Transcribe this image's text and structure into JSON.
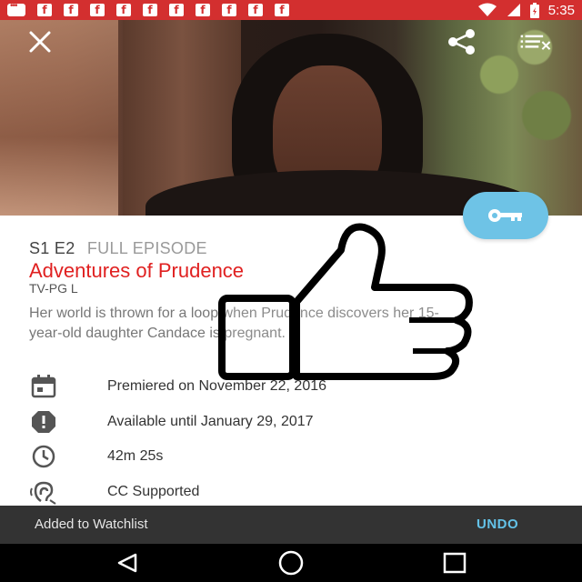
{
  "status_bar": {
    "time": "5:35",
    "notifications": [
      "message-icon",
      "facebook-icon",
      "facebook-icon",
      "facebook-icon",
      "facebook-icon",
      "facebook-icon",
      "facebook-icon",
      "facebook-icon",
      "facebook-icon",
      "facebook-icon",
      "facebook-icon"
    ],
    "indicators": [
      "wifi-icon",
      "signal-icon",
      "battery-icon"
    ],
    "background_color": "#d32f2f"
  },
  "hero": {
    "buttons": [
      "close-icon",
      "share-icon",
      "queue-icon"
    ]
  },
  "episode": {
    "season_episode": "S1 E2",
    "type": "FULL EPISODE",
    "title": "Adventures of Prudence",
    "rating": "TV-PG L",
    "description": "Her world is thrown for a loop when Prudence discovers her 15-year-old daughter Candace is pregnant.",
    "title_color": "#e02020"
  },
  "details": [
    {
      "icon": "calendar-icon",
      "text": "Premiered on November 22, 2016"
    },
    {
      "icon": "alert-icon",
      "text": "Available until January 29, 2017"
    },
    {
      "icon": "clock-icon",
      "text": "42m 25s"
    },
    {
      "icon": "closed-caption-icon",
      "text": "CC Supported"
    }
  ],
  "fab": {
    "icon": "key-icon",
    "color": "#6ec3e6"
  },
  "overlay": {
    "icon": "thumbs-up-icon"
  },
  "snackbar": {
    "message": "Added to Watchlist",
    "action": "UNDO",
    "action_color": "#63c2e8"
  },
  "nav_bar": {
    "buttons": [
      "back-icon",
      "home-icon",
      "recents-icon"
    ]
  }
}
